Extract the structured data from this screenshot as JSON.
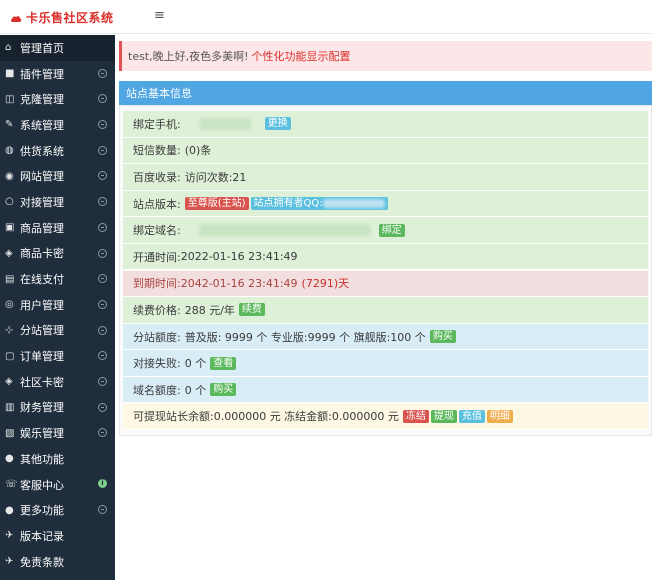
{
  "app": {
    "title": "卡乐售社区系统",
    "menu_toggle": "≡"
  },
  "sidebar": {
    "items": [
      {
        "label": "管理首页",
        "icon": "home-icon",
        "glyph": "⌂",
        "arrow": false
      },
      {
        "label": "插件管理",
        "icon": "lock-icon",
        "glyph": "■",
        "arrow": true
      },
      {
        "label": "克隆管理",
        "icon": "clone-icon",
        "glyph": "◫",
        "arrow": true
      },
      {
        "label": "系统管理",
        "icon": "wrench-icon",
        "glyph": "✎",
        "arrow": true
      },
      {
        "label": "供货系统",
        "icon": "supply-icon",
        "glyph": "◍",
        "arrow": true
      },
      {
        "label": "网站管理",
        "icon": "globe-icon",
        "glyph": "◉",
        "arrow": true
      },
      {
        "label": "对接管理",
        "icon": "link-icon",
        "glyph": "○",
        "arrow": true
      },
      {
        "label": "商品管理",
        "icon": "box-icon",
        "glyph": "▣",
        "arrow": true
      },
      {
        "label": "商品卡密",
        "icon": "key-icon",
        "glyph": "◈",
        "arrow": true
      },
      {
        "label": "在线支付",
        "icon": "payment-icon",
        "glyph": "▤",
        "arrow": true
      },
      {
        "label": "用户管理",
        "icon": "user-icon",
        "glyph": "◎",
        "arrow": true
      },
      {
        "label": "分站管理",
        "icon": "sitemap-icon",
        "glyph": "⊹",
        "arrow": true
      },
      {
        "label": "订单管理",
        "icon": "order-icon",
        "glyph": "▢",
        "arrow": true
      },
      {
        "label": "社区卡密",
        "icon": "community-key-icon",
        "glyph": "◈",
        "arrow": true
      },
      {
        "label": "财务管理",
        "icon": "chart-icon",
        "glyph": "▥",
        "arrow": true
      },
      {
        "label": "娱乐管理",
        "icon": "game-icon",
        "glyph": "▧",
        "arrow": true
      },
      {
        "label": "其他功能",
        "icon": "apple-icon",
        "glyph": "●",
        "arrow": false
      },
      {
        "label": "客服中心",
        "icon": "support-icon",
        "glyph": "☏",
        "arrow": false,
        "dot": "i"
      },
      {
        "label": "更多功能",
        "icon": "more-icon",
        "glyph": "●",
        "arrow": true
      },
      {
        "label": "版本记录",
        "icon": "version-icon",
        "glyph": "✈",
        "arrow": false
      },
      {
        "label": "免责条款",
        "icon": "terms-icon",
        "glyph": "✈",
        "arrow": false
      }
    ]
  },
  "alert": {
    "text": "test,晚上好,夜色多美啊!",
    "link": "个性化功能显示配置"
  },
  "panel": {
    "title": "站点基本信息",
    "phone_label": "绑定手机:",
    "phone_button": "更换",
    "sms_label": "短信数量:",
    "sms_value": "(0)条",
    "baidu_label": "百度收录:",
    "baidu_value": "访问次数:21",
    "version_label": "站点版本:",
    "version_tag": "至尊版(主站)",
    "version_owner": "站点拥有者QQ:",
    "domain_label": "绑定域名:",
    "domain_button": "绑定",
    "open_label": "开通时间:",
    "open_value": "2022-01-16 23:41:49",
    "expire_label": "到期时间:",
    "expire_value": "2042-01-16 23:41:49",
    "expire_days": "(7291)天",
    "renew_label": "续费价格:",
    "renew_value": "288 元/年",
    "renew_button": "续费",
    "quota_label": "分站额度:",
    "quota_value": "普及版: 9999 个 专业版:9999 个 旗舰版:100 个",
    "quota_button": "购买",
    "dock_label": "对接失败:",
    "dock_value": "0 个",
    "dock_button": "查看",
    "domain_quota_label": "域名额度:",
    "domain_quota_value": "0 个",
    "domain_quota_button": "购买",
    "balance_text": "可提现站长余额:0.000000 元 冻结金额:0.000000 元",
    "balance_buttons": [
      "冻结",
      "提现",
      "充值",
      "明细"
    ]
  }
}
